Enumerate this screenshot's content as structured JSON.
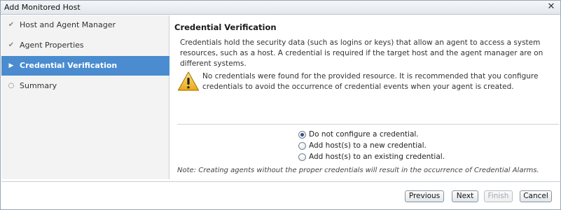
{
  "window": {
    "title": "Add Monitored Host"
  },
  "sidebar": {
    "steps": [
      {
        "label": "Host and Agent Manager",
        "state": "done"
      },
      {
        "label": "Agent Properties",
        "state": "done"
      },
      {
        "label": "Credential Verification",
        "state": "active"
      },
      {
        "label": "Summary",
        "state": "pending"
      }
    ]
  },
  "main": {
    "title": "Credential Verification",
    "intro": "Credentials hold the security data (such as logins or keys) that allow an agent to access a system resources, such as a host. A credential is required if the target host and the agent manager are on different systems.",
    "warning": "No credentials were found for the provided resource. It is recommended that you configure credentials to avoid the occurrence of credential events when your agent is created.",
    "options": [
      {
        "label": "Do not configure a credential.",
        "selected": true
      },
      {
        "label": "Add host(s) to a new credential.",
        "selected": false
      },
      {
        "label": "Add host(s) to an existing credential.",
        "selected": false
      }
    ],
    "note": "Note: Creating agents without the proper credentials will result in the occurrence of Credential Alarms."
  },
  "footer": {
    "previous": "Previous",
    "next": "Next",
    "finish": "Finish",
    "cancel": "Cancel"
  },
  "colors": {
    "accent": "#4a8ccf",
    "warning": "#f2c230"
  }
}
